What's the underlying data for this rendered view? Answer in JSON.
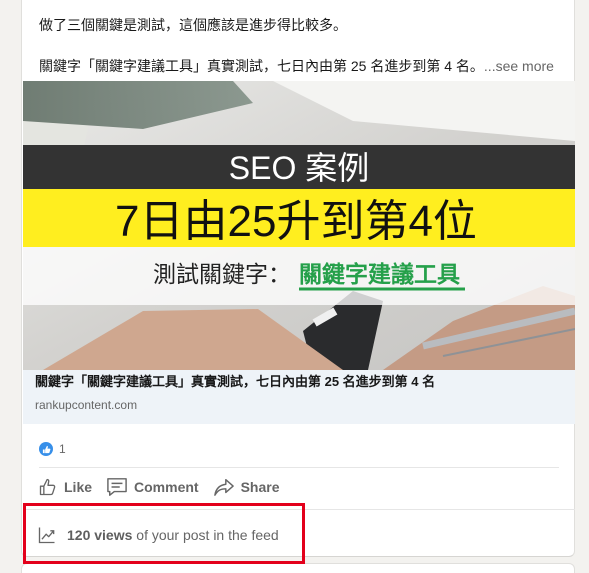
{
  "post": {
    "line1": "做了三個關鍵是測試，這個應該是進步得比較多。",
    "line2": "關鍵字「關鍵字建議工具」真實測試，七日內由第 25 名進步到第 4 名。",
    "see_more": "...see more"
  },
  "image": {
    "heading": "SEO 案例",
    "headline": "7日由25升到第4位",
    "subtitle_prefix": "測試關鍵字：",
    "subtitle_keyword": "關鍵字建議工具"
  },
  "link_preview": {
    "title": "關鍵字「關鍵字建議工具」真實測試，七日內由第 25 名進步到第 4 名",
    "domain": "rankupcontent.com"
  },
  "social": {
    "reaction_count": "1",
    "actions": {
      "like": "Like",
      "comment": "Comment",
      "share": "Share"
    }
  },
  "analytics": {
    "views_count": "120 views",
    "views_suffix": " of your post in the feed"
  },
  "colors": {
    "highlight": "#e3001b",
    "keyword_green": "#25a04a",
    "banner_yellow": "#ffee1f",
    "like_blue": "#378fe9"
  }
}
